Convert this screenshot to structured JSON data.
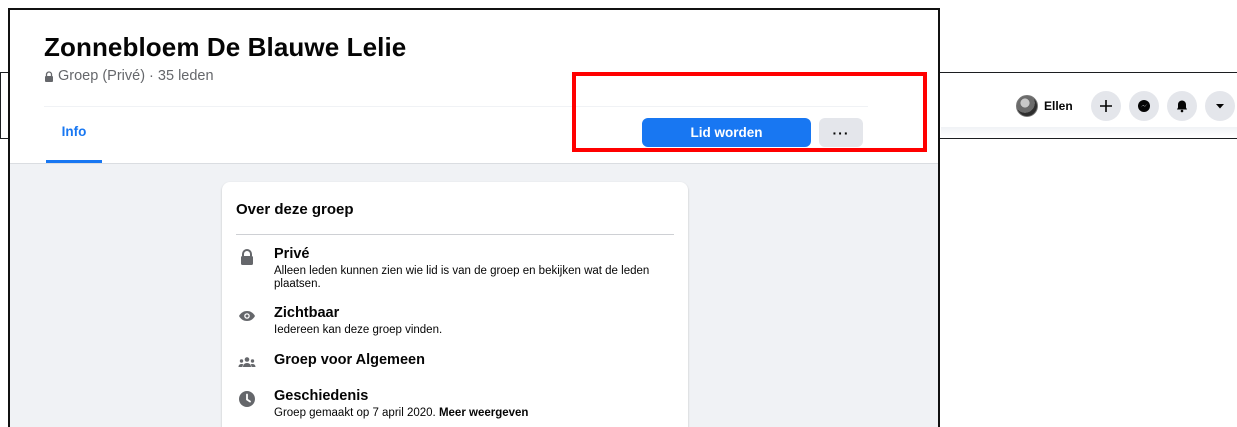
{
  "topbar": {
    "profile_name": "Ellen",
    "icons": [
      "plus-icon",
      "messenger-icon",
      "notifications-icon",
      "dropdown-arrow-icon"
    ]
  },
  "group": {
    "title": "Zonnebloem De Blauwe Lelie",
    "meta": "Groep (Privé) · 35 leden",
    "tabs": [
      {
        "label": "Info",
        "active": true
      }
    ],
    "join_label": "Lid worden",
    "more_label": "···"
  },
  "about": {
    "title": "Over deze groep",
    "rows": [
      {
        "icon": "lock-icon",
        "title": "Privé",
        "desc": "Alleen leden kunnen zien wie lid is van de groep en bekijken wat de leden plaatsen."
      },
      {
        "icon": "eye-icon",
        "title": "Zichtbaar",
        "desc": "Iedereen kan deze groep vinden."
      },
      {
        "icon": "people-icon",
        "title": "Groep voor Algemeen",
        "desc": ""
      },
      {
        "icon": "clock-icon",
        "title": "Geschiedenis",
        "desc": "Groep gemaakt op 7 april 2020.",
        "link": "Meer weergeven"
      }
    ]
  },
  "colors": {
    "accent": "#1877f2",
    "background": "#f0f2f5",
    "highlight": "#ff0000",
    "secondary_text": "#65676b"
  }
}
